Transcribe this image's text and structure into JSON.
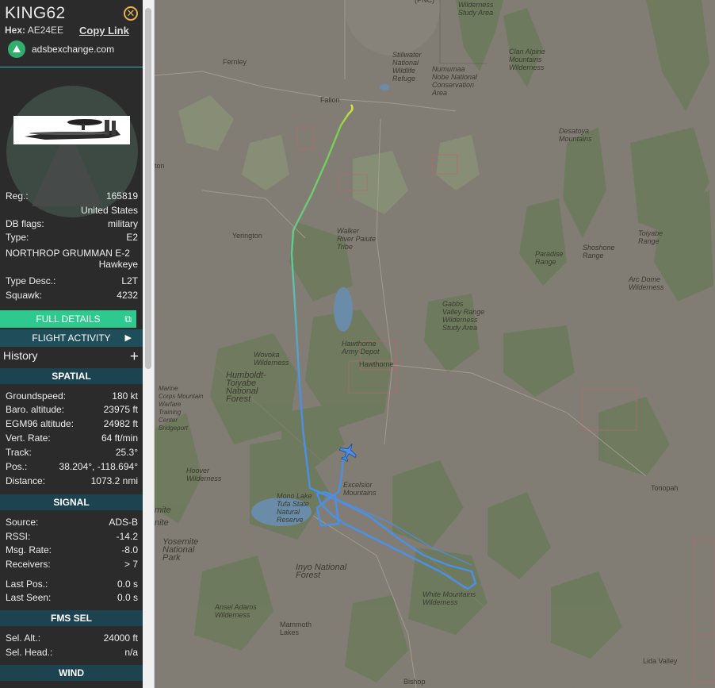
{
  "aircraft": {
    "callsign": "KING62",
    "hex_label": "Hex:",
    "hex_value": "AE24EE",
    "copy_link": "Copy Link",
    "source_site": "adsbexchange.com",
    "close_icon": "close-icon",
    "photo_icon": "aircraft-photo"
  },
  "details": [
    {
      "label": "Reg.:",
      "value": "165819"
    },
    {
      "label": "",
      "value": "United States"
    },
    {
      "label": "DB flags:",
      "value": "military"
    },
    {
      "label": "Type:",
      "value": "E2"
    },
    {
      "label": "NORTHROP GRUMMAN E-2",
      "value": ""
    },
    {
      "label": "",
      "value": "Hawkeye"
    },
    {
      "label": "Type Desc.:",
      "value": "L2T"
    },
    {
      "label": "Squawk:",
      "value": "4232"
    }
  ],
  "buttons": {
    "full_details": "FULL DETAILS",
    "flight_activity": "FLIGHT ACTIVITY"
  },
  "history_label": "History",
  "sections": {
    "spatial": "SPATIAL",
    "signal": "SIGNAL",
    "fms_sel": "FMS SEL",
    "wind": "WIND"
  },
  "spatial": [
    {
      "label": "Groundspeed:",
      "value": "180 kt"
    },
    {
      "label": "Baro. altitude:",
      "value": "23975 ft"
    },
    {
      "label": "EGM96 altitude:",
      "value": "24982 ft"
    },
    {
      "label": "Vert. Rate:",
      "value": "64 ft/min"
    },
    {
      "label": "Track:",
      "value": "25.3°"
    },
    {
      "label": "Pos.:",
      "value": "38.204°, -118.694°"
    },
    {
      "label": "Distance:",
      "value": "1073.2 nmi"
    }
  ],
  "signal": [
    {
      "label": "Source:",
      "value": "ADS-B"
    },
    {
      "label": "RSSI:",
      "value": "-14.2"
    },
    {
      "label": "Msg. Rate:",
      "value": "-8.0"
    },
    {
      "label": "Receivers:",
      "value": "> 7"
    },
    {
      "label": "Last Pos.:",
      "value": "0.0 s"
    },
    {
      "label": "Last Seen:",
      "value": "0.0 s"
    }
  ],
  "fms": [
    {
      "label": "Sel. Alt.:",
      "value": "24000 ft"
    },
    {
      "label": "Sel. Head.:",
      "value": "n/a"
    }
  ],
  "map_labels": {
    "fallon": "Fallon",
    "fernley": "Fernley",
    "yerington": "Yerington",
    "hawthorne": "Hawthorne",
    "hawthorne_depot": "Hawthorne\nArmy Depot",
    "walker": "Walker\nRiver Paiute\nTribe",
    "humboldt": "Humboldt-\nToiyabe\nNational\nForest",
    "stillwater": "Stillwater\nNational\nWildlife\nRefuge",
    "numumaa": "Numumaa\nNobe National\nConservation\nArea",
    "clan_alpine": "Clan Alpine\nMountains\nWilderness",
    "desatoya": "Desatoya\nMountains",
    "paradise": "Paradise\nRange",
    "shoshone": "Shoshone\nRange",
    "toiyabe": "Toiyabe\nRange",
    "arc_dome": "Arc Dome\nWilderness",
    "gabbs": "Gabbs\nValley Range\nWilderness\nStudy Area",
    "wovoka": "Wovoka\nWilderness",
    "excelsior": "Excelsior\nMountains",
    "mono": "Mono Lake\nTufa State\nNatural\nReserve",
    "inyo": "Inyo National\nForest",
    "white_mtn": "White Mountains\nWilderness",
    "ansel": "Ansel Adams\nWilderness",
    "mammoth": "Mammoth\nLakes",
    "yosemite": "Yosemite\nNational\nPark",
    "hoover": "Hoover\nWilderness",
    "marine": "Marine\nCorps Mountain\nWarfare\nTraining\nCenter\nBridgeport",
    "tonopah": "Tonopah",
    "bishop": "Bishop",
    "lida": "Lida Valley",
    "wilderness_top": "Wilderness\nStudy Area",
    "mite": "mite",
    "nite": "nite",
    "ton": "ton",
    "pnc": "(PNC)"
  },
  "colors": {
    "panel_bg": "#2b2b2b",
    "full_details_bg": "#2ec98e",
    "section_bg": "#1d4250",
    "track_green": "#7bd04a",
    "track_blue": "#4a90e8",
    "track_yellow": "#e8e83a"
  }
}
